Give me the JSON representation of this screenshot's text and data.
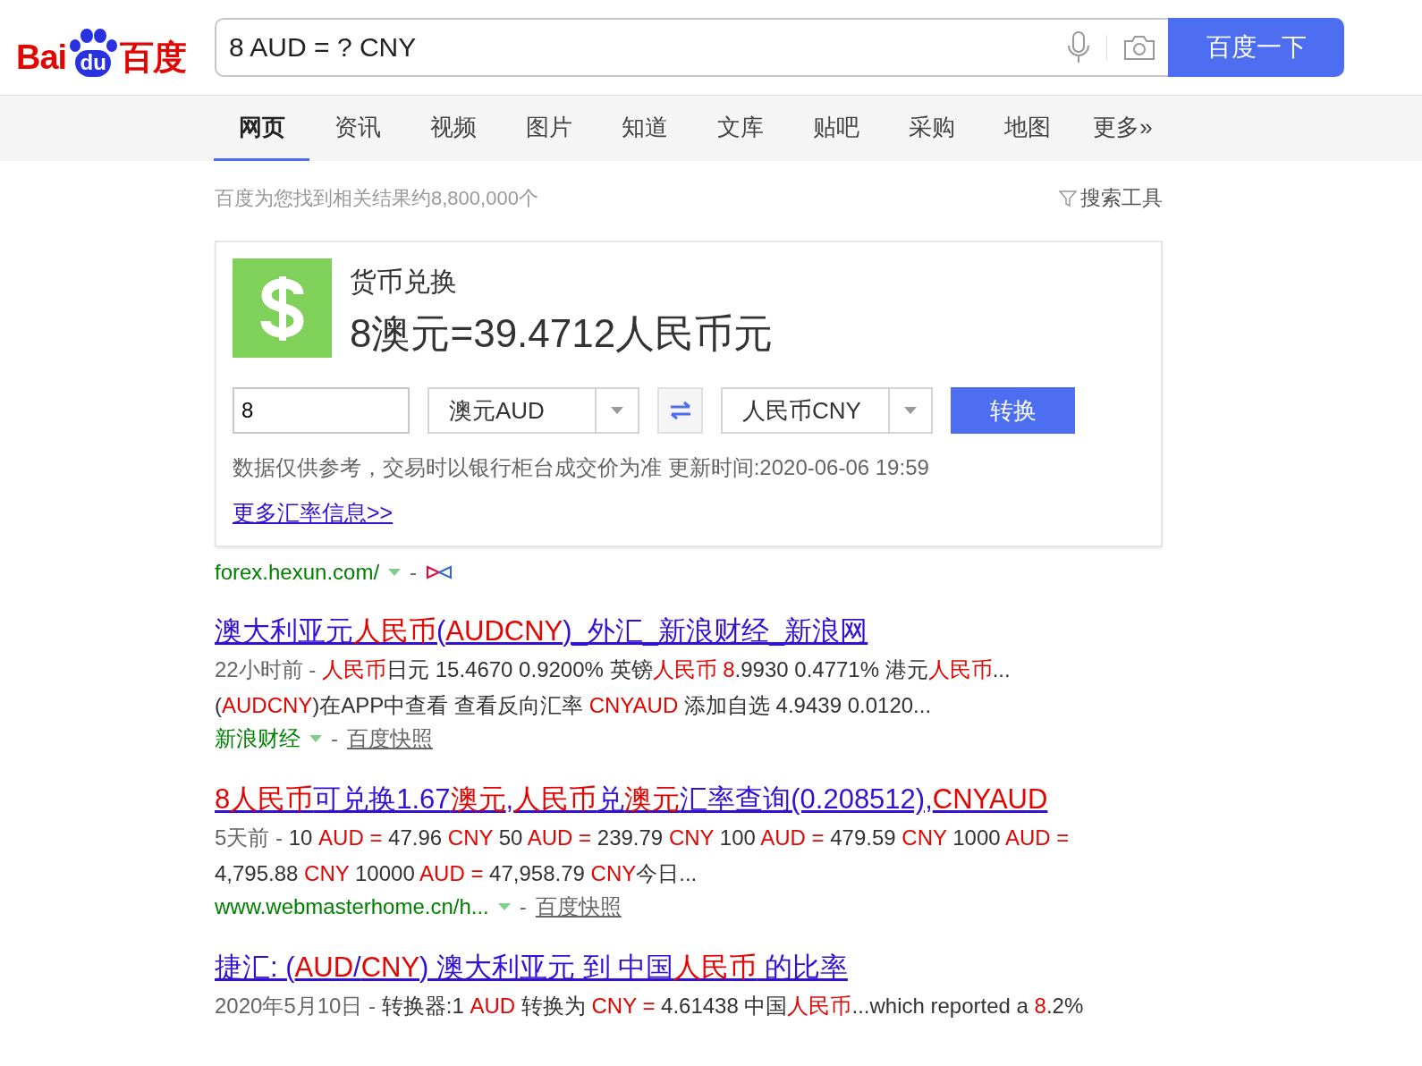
{
  "logo": {
    "left": "Bai",
    "badge": "du",
    "right": "百度"
  },
  "search": {
    "value": "8 AUD = ? CNY",
    "button": "百度一下"
  },
  "tabs": [
    {
      "label": "网页",
      "selected": true
    },
    {
      "label": "资讯",
      "selected": false
    },
    {
      "label": "视频",
      "selected": false
    },
    {
      "label": "图片",
      "selected": false
    },
    {
      "label": "知道",
      "selected": false
    },
    {
      "label": "文库",
      "selected": false
    },
    {
      "label": "贴吧",
      "selected": false
    },
    {
      "label": "采购",
      "selected": false
    },
    {
      "label": "地图",
      "selected": false
    },
    {
      "label": "更多»",
      "selected": false
    }
  ],
  "result_count": "百度为您找到相关结果约8,800,000个",
  "search_tools": "搜索工具",
  "converter": {
    "title": "货币兑换",
    "result": "8澳元=39.4712人民币元",
    "amount": "8",
    "from": "澳元AUD",
    "to": "人民币CNY",
    "button": "转换",
    "note": "数据仅供参考，交易时以银行柜台成交价为准 更新时间:2020-06-06 19:59",
    "more_link": "更多汇率信息>>",
    "source": "forex.hexun.com/",
    "source_sep": "-"
  },
  "results": [
    {
      "title": "澳大利亚元**人民币**(**AUDCNY**)_外汇_新浪财经_新浪网",
      "date": "22小时前 -",
      "lines": [
        " **人民币**日元 15.4670 0.9200% 英镑**人民币 8**.9930 0.4771% 港元**人民币**...",
        "(**AUDCNY**)在APP中查看 查看反向汇率 **CNYAUD** 添加自选 4.9439 0.0120..."
      ],
      "source": "新浪财经",
      "sep": "-",
      "cache": "百度快照"
    },
    {
      "title": "**8人民币**可兑换1.67**澳元**,**人民币**兑**澳元**汇率查询(0.208512),**CNYAUD**",
      "date": "5天前 -",
      "lines": [
        " 10 **AUD =** 47.96 **CNY** 50 **AUD =** 239.79 **CNY** 100 **AUD =** 479.59 **CNY** 1000 **AUD =**",
        "4,795.88 **CNY** 10000 **AUD =** 47,958.79 **CNY**今日..."
      ],
      "source": "www.webmasterhome.cn/h...",
      "sep": "-",
      "cache": "百度快照"
    },
    {
      "title": "捷汇: (**AUD**/**CNY**) 澳大利亚元 到 中国**人民币** 的比率",
      "date": "2020年5月10日 -",
      "lines": [
        " 转换器:1 **AUD** 转换为 **CNY =** 4.61438 中国**人民币**...which reported a **8**.2%"
      ]
    }
  ]
}
